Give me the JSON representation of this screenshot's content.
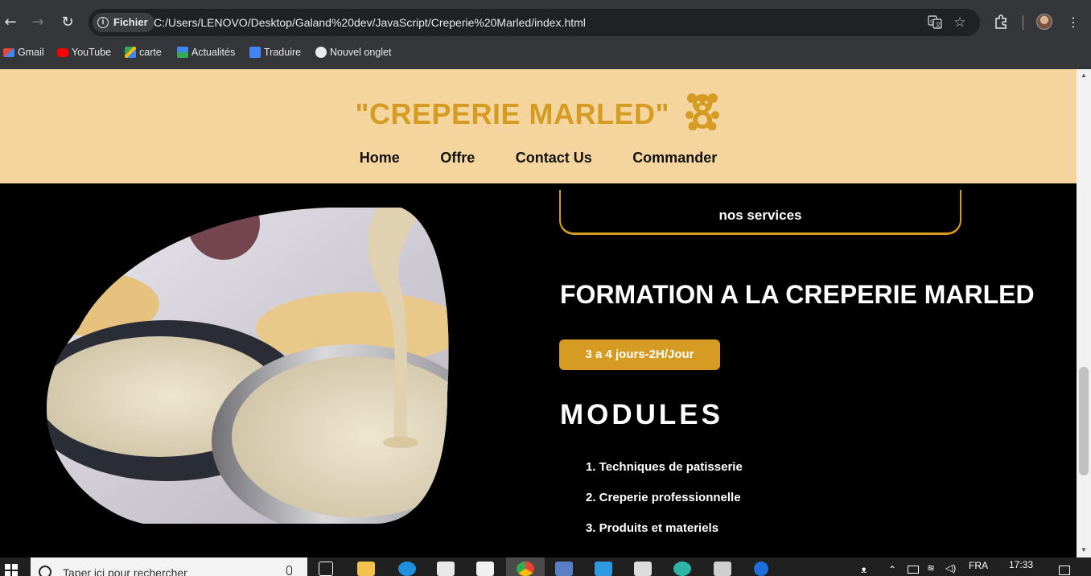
{
  "browser": {
    "chip_label": "Fichier",
    "url": "C:/Users/LENOVO/Desktop/Galand%20dev/JavaScript/Creperie%20Marled/index.html",
    "bookmarks": [
      "Gmail",
      "YouTube",
      "carte",
      "Actualités",
      "Traduire",
      "Nouvel onglet"
    ]
  },
  "site": {
    "logo_text": "\"CREPERIE MARLED\"",
    "nav": [
      "Home",
      "Offre",
      "Contact Us",
      "Commander"
    ],
    "services_title": "nos services",
    "formation_title": "FORMATION A LA CREPERIE MARLED",
    "duration_badge": "3 a 4 jours-2H/Jour",
    "modules_title": "MODULES",
    "modules": [
      "1. Techniques de patisserie",
      "2. Creperie professionnelle",
      "3. Produits et materiels"
    ]
  },
  "taskbar": {
    "search_placeholder": "Taper ici pour rechercher",
    "language": "FRA",
    "time": "17:33"
  },
  "colors": {
    "header_bg": "#f5d59e",
    "accent": "#d59b23",
    "page_bg": "#000000",
    "chrome_bg": "#35363a"
  }
}
